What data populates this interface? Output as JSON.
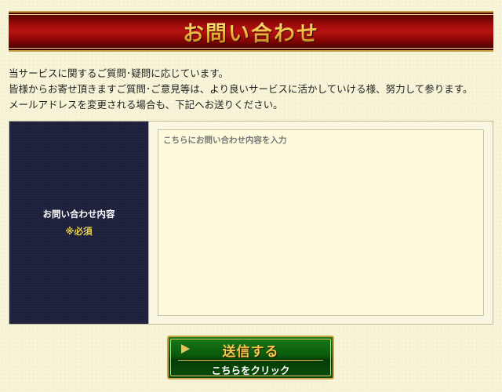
{
  "header": {
    "title": "お問い合わせ"
  },
  "intro": {
    "lines": [
      "当サービスに関するご質問･疑問に応じています。",
      "皆様からお寄せ頂きますご質問･ご意見等は、より良いサービスに活かしていける様、努力して参ります。",
      "メールアドレスを変更される場合も、下記へお送りください。"
    ]
  },
  "form": {
    "field_label": "お問い合わせ内容",
    "required_label": "※必須",
    "message_placeholder": "こちらにお問い合わせ内容を入力",
    "message_value": ""
  },
  "submit": {
    "main_label": "送信する",
    "sub_label": "こちらをクリック",
    "arrow_icon": "play-arrow-icon"
  },
  "colors": {
    "title_bar": "#9b0a0a",
    "title_text_gold": "#f0c24a",
    "label_cell_bg": "#1c1f3b",
    "required_text": "#e9d14a",
    "button_green": "#0b5a0b",
    "page_bg": "#f7f4d8"
  }
}
